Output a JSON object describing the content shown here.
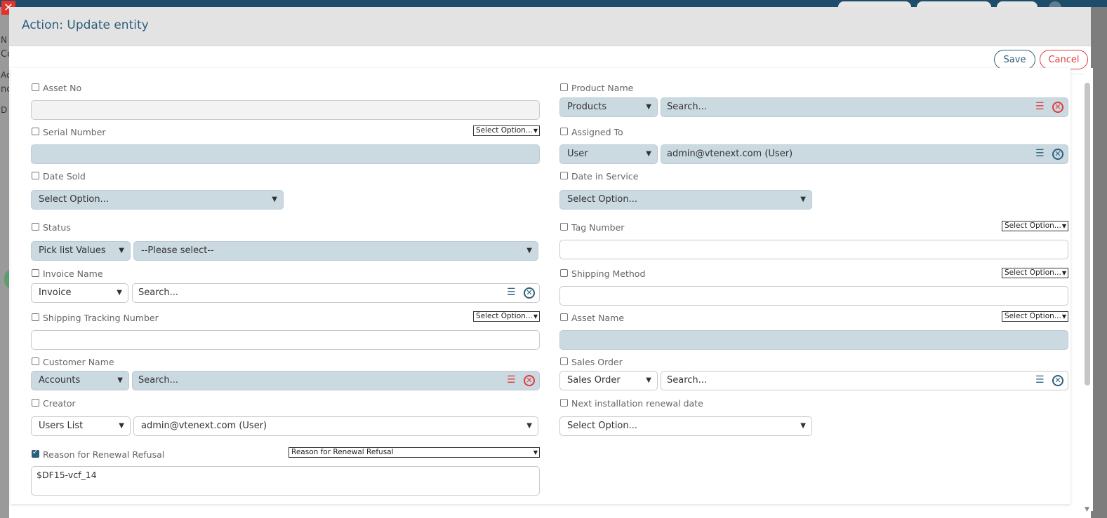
{
  "modal": {
    "title": "Action: Update entity",
    "save_label": "Save",
    "cancel_label": "Cancel"
  },
  "background": {
    "letters": [
      "N",
      "Co",
      "Ac",
      "nc",
      "D"
    ]
  },
  "placeholders": {
    "search": "Search...",
    "select_option": "Select Option...",
    "please_select": "--Please select--"
  },
  "fields": {
    "asset_no": {
      "label": "Asset No",
      "checked": false
    },
    "product_name": {
      "label": "Product Name",
      "checked": false,
      "module": "Products"
    },
    "serial_number": {
      "label": "Serial Number",
      "checked": false,
      "option": "Select Option..."
    },
    "assigned_to": {
      "label": "Assigned To",
      "checked": false,
      "type": "User",
      "value": "admin@vtenext.com (User)"
    },
    "date_sold": {
      "label": "Date Sold",
      "checked": false,
      "value": "Select Option..."
    },
    "date_in_service": {
      "label": "Date in Service",
      "checked": false,
      "value": "Select Option..."
    },
    "status": {
      "label": "Status",
      "checked": false,
      "source": "Pick list Values",
      "value": "--Please select--"
    },
    "tag_number": {
      "label": "Tag Number",
      "checked": false,
      "option": "Select Option..."
    },
    "invoice_name": {
      "label": "Invoice Name",
      "checked": false,
      "module": "Invoice"
    },
    "shipping_method": {
      "label": "Shipping Method",
      "checked": false,
      "option": "Select Option..."
    },
    "shipping_tracking_number": {
      "label": "Shipping Tracking Number",
      "checked": false,
      "option": "Select Option..."
    },
    "asset_name": {
      "label": "Asset Name",
      "checked": false,
      "option": "Select Option..."
    },
    "customer_name": {
      "label": "Customer Name",
      "checked": false,
      "module": "Accounts"
    },
    "sales_order": {
      "label": "Sales Order",
      "checked": false,
      "module": "Sales Order"
    },
    "creator": {
      "label": "Creator",
      "checked": false,
      "source": "Users List",
      "value": "admin@vtenext.com (User)"
    },
    "next_installation_renewal_date": {
      "label": "Next installation renewal date",
      "checked": false,
      "value": "Select Option..."
    },
    "reason_for_renewal_refusal": {
      "label": "Reason for Renewal Refusal",
      "checked": true,
      "option": "Reason for Renewal Refusal",
      "value": "$DF15-vcf_14"
    }
  },
  "colors": {
    "accent": "#2c5f7c",
    "danger": "#e03b3b",
    "field_blue": "#cbd9e1"
  }
}
